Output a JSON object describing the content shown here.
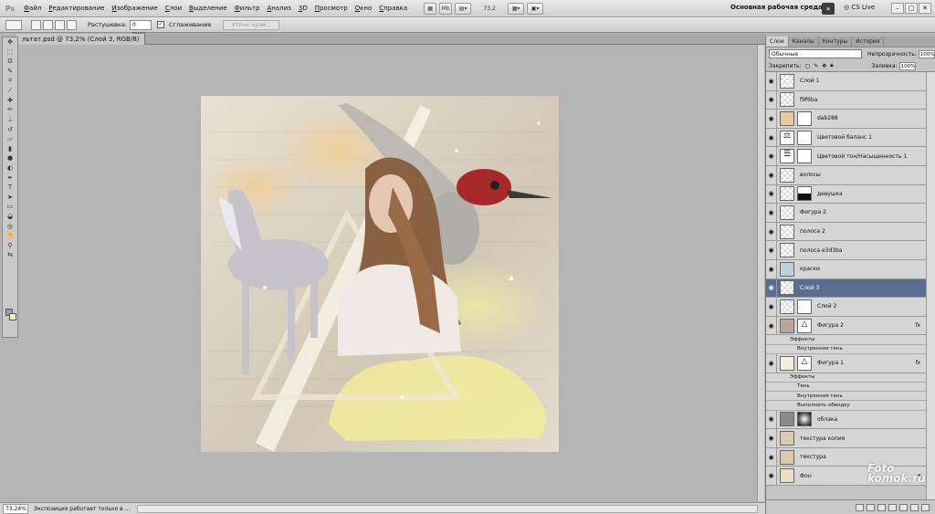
{
  "menubar": {
    "logo": "Ps",
    "items": [
      "Файл",
      "Редактирование",
      "Изображение",
      "Слои",
      "Выделение",
      "Фильтр",
      "Анализ",
      "3D",
      "Просмотр",
      "Окно",
      "Справка"
    ],
    "zoom_value": "73,2",
    "workspace": "Основная рабочая среда",
    "cs_live": "CS Live"
  },
  "options": {
    "feather_label": "Растушевка:",
    "feather_value": "0 пикс",
    "antialias_label": "Сглаживание",
    "refine_label": "Уточн. край..."
  },
  "document": {
    "tab_title": "льтат.psd @ 73,2% (Слой 3, RGB/8)"
  },
  "status": {
    "zoom": "73,24%",
    "text": "Экспозиция работает только в ..."
  },
  "panel": {
    "tabs": [
      "Слои",
      "Каналы",
      "Контуры",
      "История"
    ],
    "blend_mode": "Обычные",
    "opacity_label": "Непрозрачность:",
    "opacity": "100%",
    "lock_label": "Закрепить:",
    "fill_label": "Заливка:",
    "fill": "100%",
    "layers": [
      {
        "name": "Слой 1"
      },
      {
        "name": "f9f6ba"
      },
      {
        "name": "dab288"
      },
      {
        "name": "Цветовой баланс 1"
      },
      {
        "name": "Цветовой тон/Насыщенность 1"
      },
      {
        "name": "волосы"
      },
      {
        "name": "девушка"
      },
      {
        "name": "Фигура 2"
      },
      {
        "name": "полоса 2"
      },
      {
        "name": "полоса e3d3ba"
      },
      {
        "name": "краски"
      },
      {
        "name": "Слой 3"
      },
      {
        "name": "Слой 2"
      },
      {
        "name": "Фигура 2",
        "fx": "fx"
      },
      {
        "name": "Фигура 1",
        "fx": "fx"
      },
      {
        "name": "облака"
      },
      {
        "name": "текстура копия"
      },
      {
        "name": "текстура"
      },
      {
        "name": "Фон"
      }
    ],
    "effects_label": "Эффекты",
    "effect_inner_shadow": "Внутренняя тень",
    "effect_shadow": "Тень",
    "effect_stroke": "Выполнить обводку"
  },
  "watermark": {
    "line1": "Foto",
    "line2": "komok.ru"
  }
}
